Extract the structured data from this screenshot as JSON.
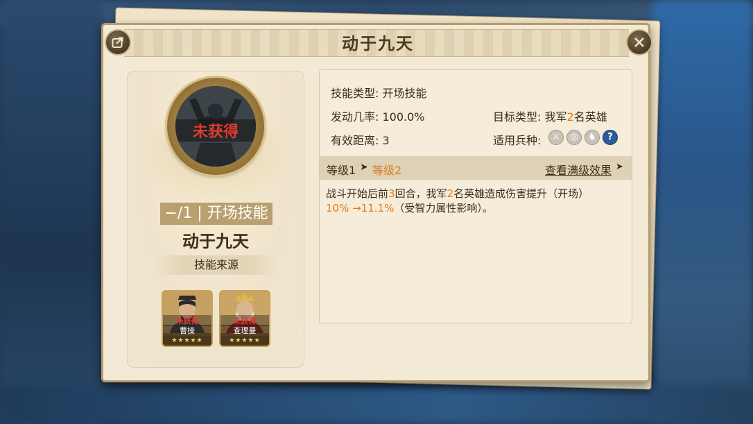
{
  "title": "动于九天",
  "left": {
    "icon_status": "未获得",
    "skill_tag": "−/1 | 开场技能",
    "skill_name": "动于九天",
    "source_label": "技能来源",
    "heroes": [
      {
        "status": "未获得",
        "name": "曹操",
        "stars": "★★★★★"
      },
      {
        "status": "未获得",
        "name": "查理曼",
        "stars": "★★★★★"
      }
    ]
  },
  "info": {
    "skill_type_label": "技能类型:",
    "skill_type_value": "开场技能",
    "trigger_rate_label": "发动几率:",
    "trigger_rate_value": "100.0%",
    "range_label": "有效距离:",
    "range_value": "3",
    "target_label": "目标类型:",
    "target_pre": "我军",
    "target_num": "2",
    "target_post": "名英雄",
    "unit_label": "适用兵种:",
    "unit_icons": [
      "sword-icon",
      "target-icon",
      "horse-icon",
      "question-icon"
    ]
  },
  "level": {
    "level1": "等级1",
    "level2": "等级2",
    "max_link": "查看满级效果"
  },
  "description": {
    "p1": "战斗开始后前",
    "n1": "3",
    "p2": "回合，我军",
    "n2": "2",
    "p3": "名英雄造成伤害提升（开场）",
    "range": "10% →11.1%",
    "p4": "（受智力属性影响）。"
  }
}
